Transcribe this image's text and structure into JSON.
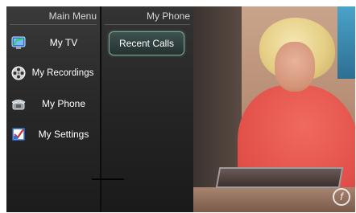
{
  "main_menu": {
    "header": "Main Menu",
    "items": [
      {
        "label": "My TV",
        "icon": "tv-icon"
      },
      {
        "label": "My Recordings",
        "icon": "film-reel-icon"
      },
      {
        "label": "My Phone",
        "icon": "telephone-icon"
      },
      {
        "label": "My Settings",
        "icon": "settings-icon"
      }
    ]
  },
  "sub_menu": {
    "header": "My Phone",
    "items": [
      {
        "label": "Recent Calls"
      }
    ]
  },
  "video": {
    "channel_logo": "f"
  },
  "colors": {
    "accent": "#7fa39b",
    "panel": "#2a2a2a",
    "text": "#ffffff"
  }
}
